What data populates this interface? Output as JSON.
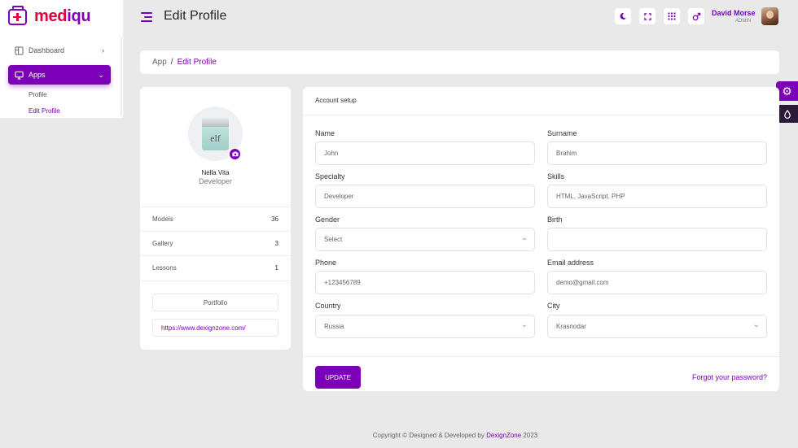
{
  "brand": {
    "part1": "med",
    "part2": "iqu"
  },
  "sidebar": {
    "items": [
      {
        "label": "Dashboard"
      },
      {
        "label": "Apps"
      }
    ],
    "sub_items": [
      {
        "label": "Profile"
      },
      {
        "label": "Edit Profile"
      }
    ]
  },
  "header": {
    "title": "Edit Profile",
    "user_name": "David Morse",
    "user_role": "ADMIN",
    "icons": [
      "moon-icon",
      "fullscreen-icon",
      "grid-icon",
      "gender-icon"
    ]
  },
  "breadcrumb": {
    "root": "App",
    "separator": "/",
    "current": "Edit Profile"
  },
  "profile": {
    "name": "Nella Vita",
    "role": "Developer",
    "product_label": "elf",
    "stats": [
      {
        "label": "Models",
        "value": "36"
      },
      {
        "label": "Gallery",
        "value": "3"
      },
      {
        "label": "Lessons",
        "value": "1"
      }
    ],
    "portfolio_label": "Portfolio",
    "url": "https://www.dexignzone.com/"
  },
  "account": {
    "title": "Account setup",
    "fields": {
      "name": {
        "label": "Name",
        "value": "John"
      },
      "surname": {
        "label": "Surname",
        "value": "Brahim"
      },
      "specialty": {
        "label": "Specialty",
        "value": "Developer"
      },
      "skills": {
        "label": "Skills",
        "value": "HTML,  JavaScript,  PHP"
      },
      "gender": {
        "label": "Gender",
        "value": "Select"
      },
      "birth": {
        "label": "Birth",
        "value": ""
      },
      "phone": {
        "label": "Phone",
        "value": "+123456789"
      },
      "email": {
        "label": "Email address",
        "value": "demo@gmail.com"
      },
      "country": {
        "label": "Country",
        "value": "Russia"
      },
      "city": {
        "label": "City",
        "value": "Krasnodar"
      }
    },
    "update_label": "UPDATE",
    "forgot_label": "Forgot your password?"
  },
  "footer": {
    "prefix": "Copyright © Designed & Developed by ",
    "brand": "DexignZone",
    "year": " 2023"
  },
  "colors": {
    "accent": "#7c00b8",
    "logo_red": "#e00040",
    "background": "#e9e9e9"
  }
}
